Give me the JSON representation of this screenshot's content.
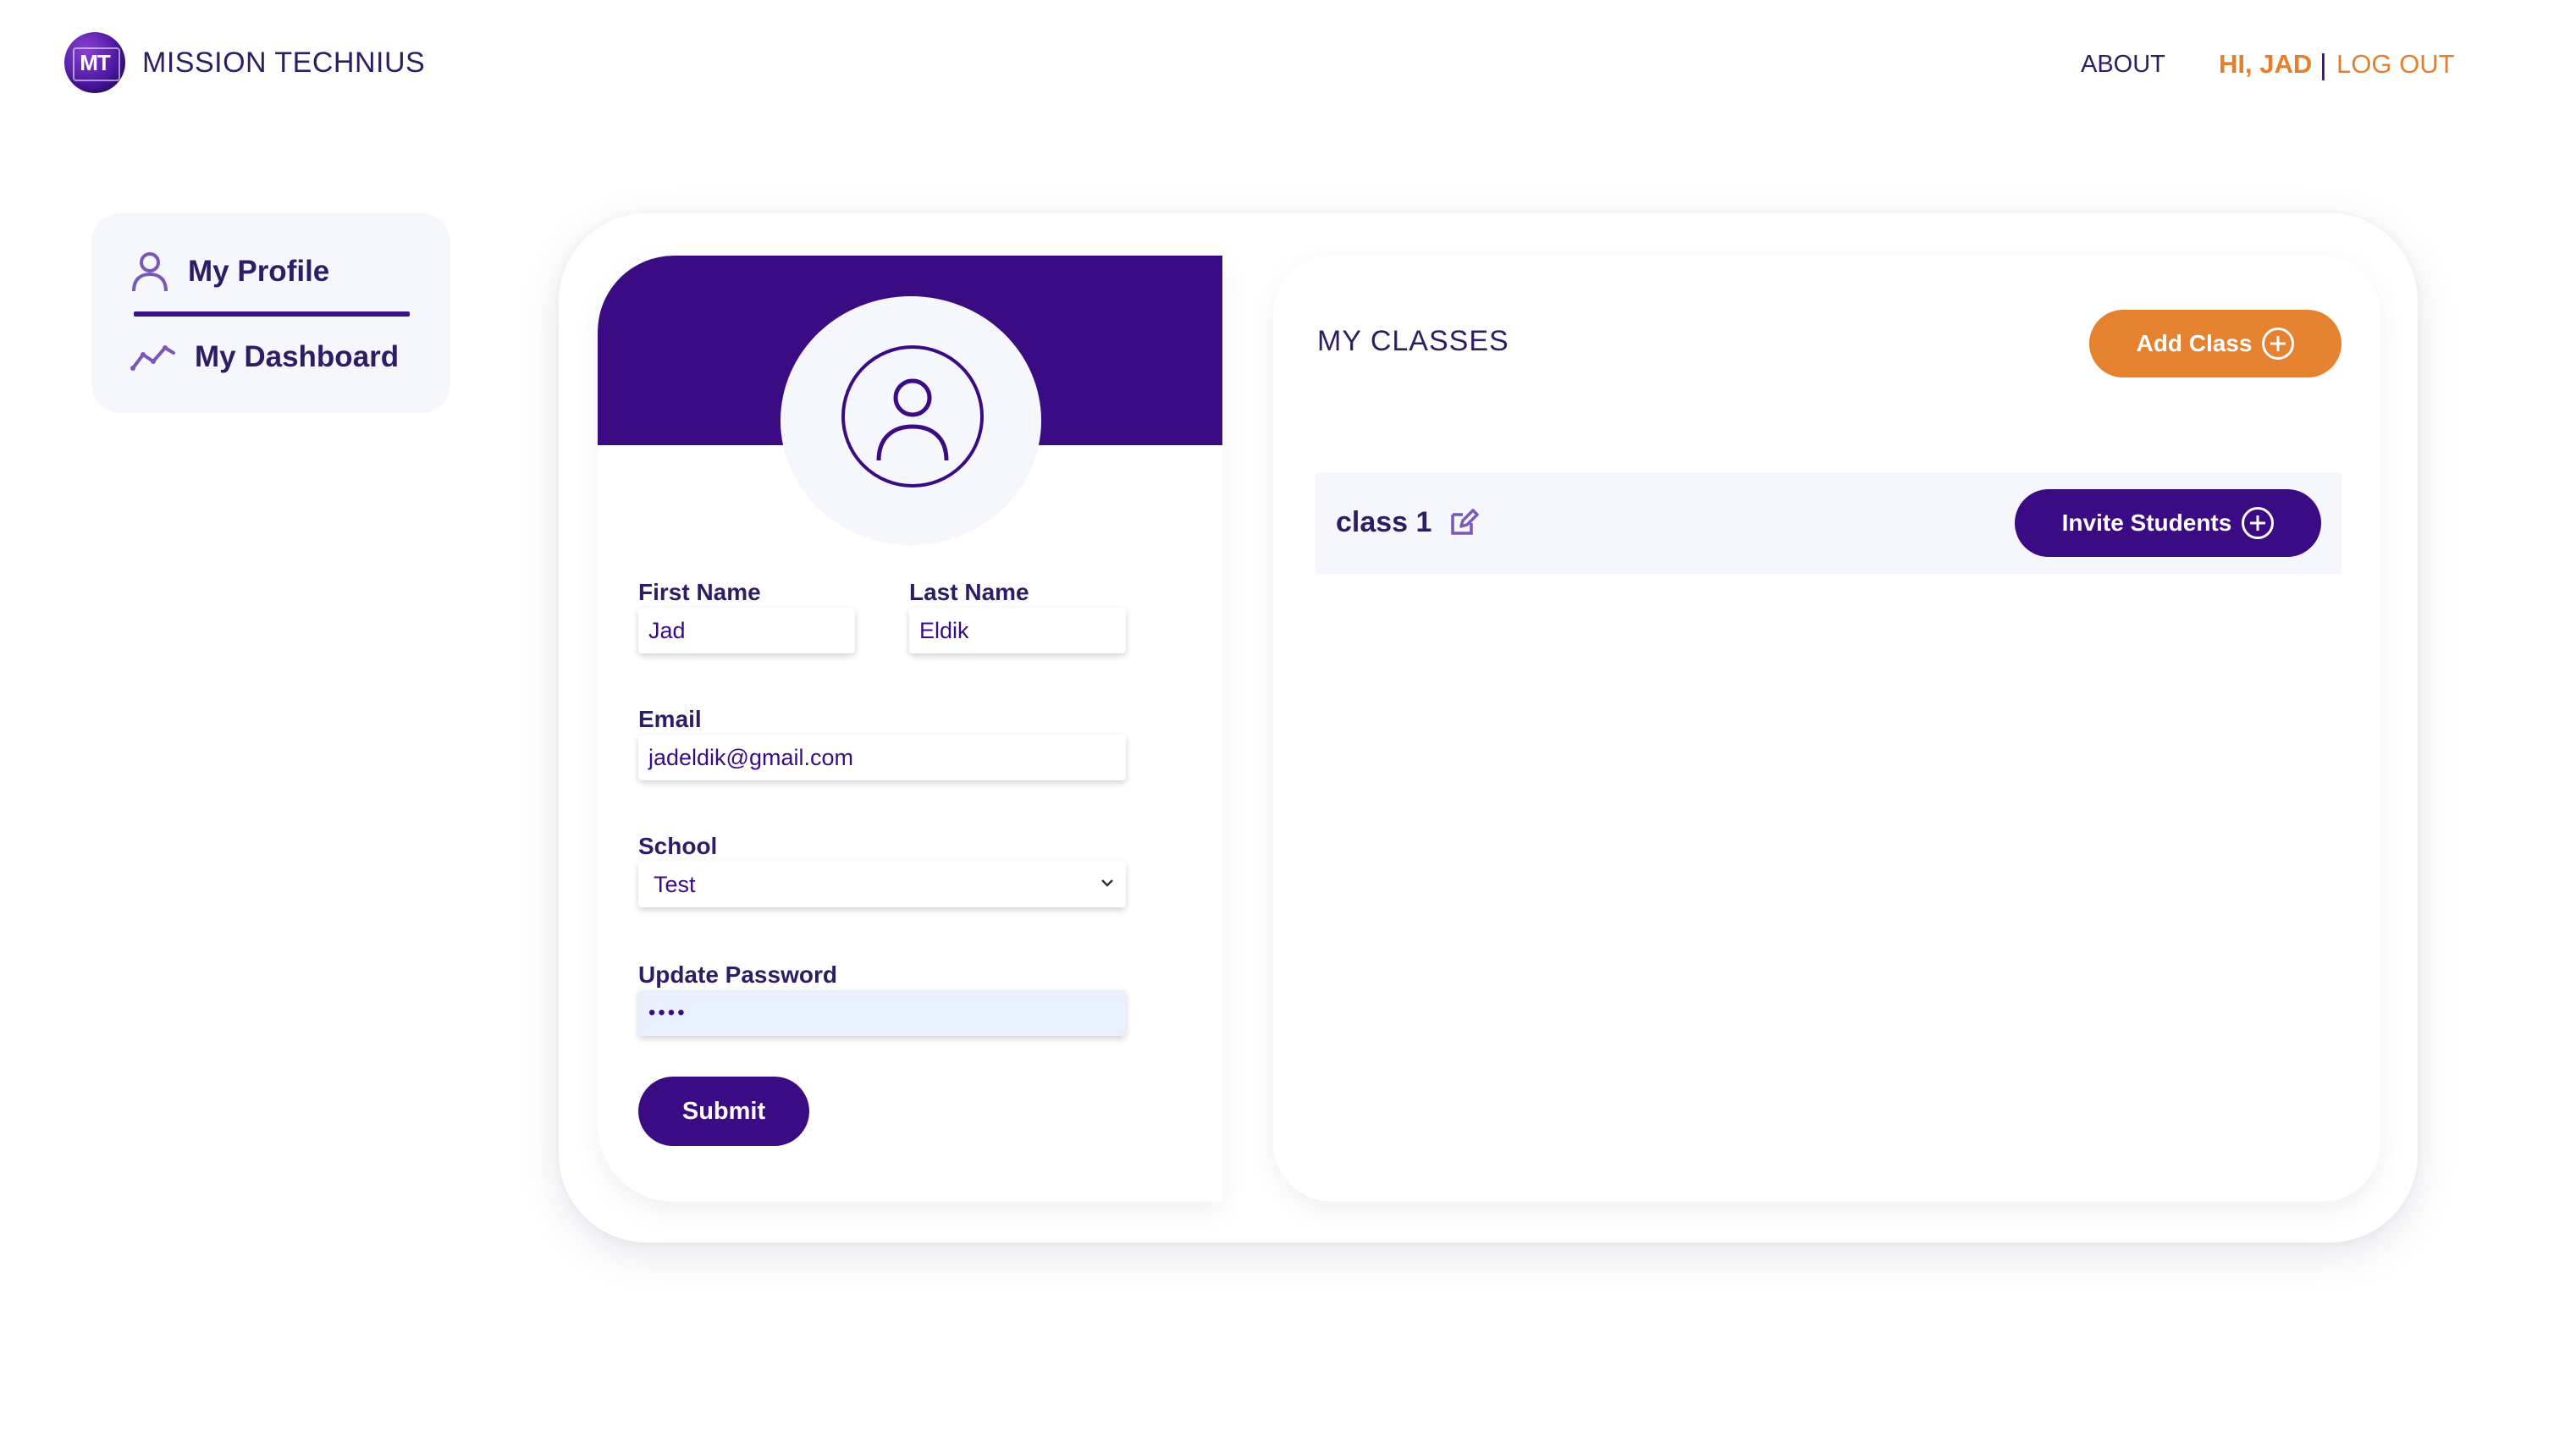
{
  "header": {
    "logo_initials": "MT",
    "app_name": "MISSION TECHNIUS",
    "nav_about": "ABOUT",
    "greeting": "HI, JAD",
    "separator": "|",
    "logout": "LOG OUT"
  },
  "sidebar": {
    "items": [
      {
        "label": "My Profile",
        "icon": "user-icon",
        "active": true
      },
      {
        "label": "My Dashboard",
        "icon": "trend-line-icon",
        "active": false
      }
    ]
  },
  "profile_form": {
    "first_name": {
      "label": "First Name",
      "value": "Jad"
    },
    "last_name": {
      "label": "Last Name",
      "value": "Eldik"
    },
    "email": {
      "label": "Email",
      "value": "jadeldik@gmail.com"
    },
    "school": {
      "label": "School",
      "value": "Test"
    },
    "password": {
      "label": "Update Password",
      "value": "••••"
    },
    "submit_label": "Submit"
  },
  "classes": {
    "title": "MY CLASSES",
    "add_label": "Add Class",
    "items": [
      {
        "name": "class 1",
        "invite_label": "Invite Students"
      }
    ]
  },
  "colors": {
    "primary_purple": "#3b0b84",
    "accent_orange": "#e58230",
    "panel_tint": "#f5f7fd"
  }
}
